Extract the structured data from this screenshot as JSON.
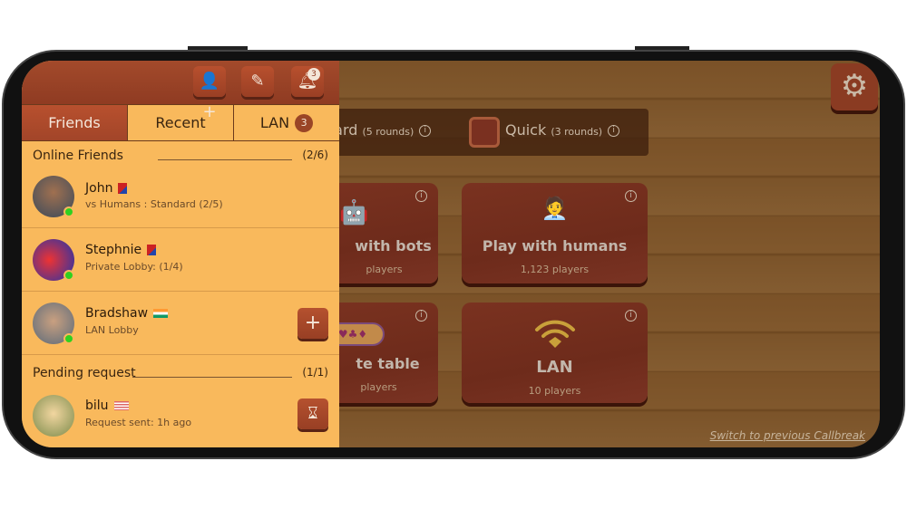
{
  "panel": {
    "header_buttons": [
      {
        "icon": "add-friend-icon"
      },
      {
        "icon": "edit-icon"
      },
      {
        "icon": "bell-icon",
        "badge": "3"
      }
    ],
    "tabs": [
      {
        "label": "Friends",
        "active": true
      },
      {
        "label": "Recent"
      },
      {
        "label": "LAN",
        "count": "3"
      }
    ],
    "online": {
      "title": "Online Friends",
      "count": "(2/6)",
      "friends": [
        {
          "name": "John",
          "status": "vs Humans  : Standard (2/5)",
          "flag": "nepal",
          "online": true
        },
        {
          "name": "Stephnie",
          "status": "Private Lobby: (1/4)",
          "flag": "nepal",
          "online": true
        },
        {
          "name": "Bradshaw",
          "status": "LAN Lobby",
          "flag": "india",
          "online": true,
          "action": "plus-icon"
        }
      ]
    },
    "pending": {
      "title": "Pending request",
      "count": "(1/1)",
      "items": [
        {
          "name": "bilu",
          "status": "Request sent: 1h ago",
          "flag": "usa",
          "action": "hourglass-icon"
        }
      ]
    }
  },
  "modes": [
    {
      "label": "dard",
      "rounds": "(5 rounds)"
    },
    {
      "label": "Quick",
      "rounds": "(3 rounds)"
    }
  ],
  "cards": [
    {
      "title": "with bots",
      "players": "players"
    },
    {
      "title": "Play with humans",
      "players": "1,123 players"
    },
    {
      "title": "te table",
      "players": "players"
    },
    {
      "title": "LAN",
      "players": "10 players"
    }
  ],
  "switch_link": "Switch to previous Callbreak",
  "colors": {
    "panel": "#f9b95c",
    "accent": "#a34a2b",
    "online": "#2fd11f"
  }
}
